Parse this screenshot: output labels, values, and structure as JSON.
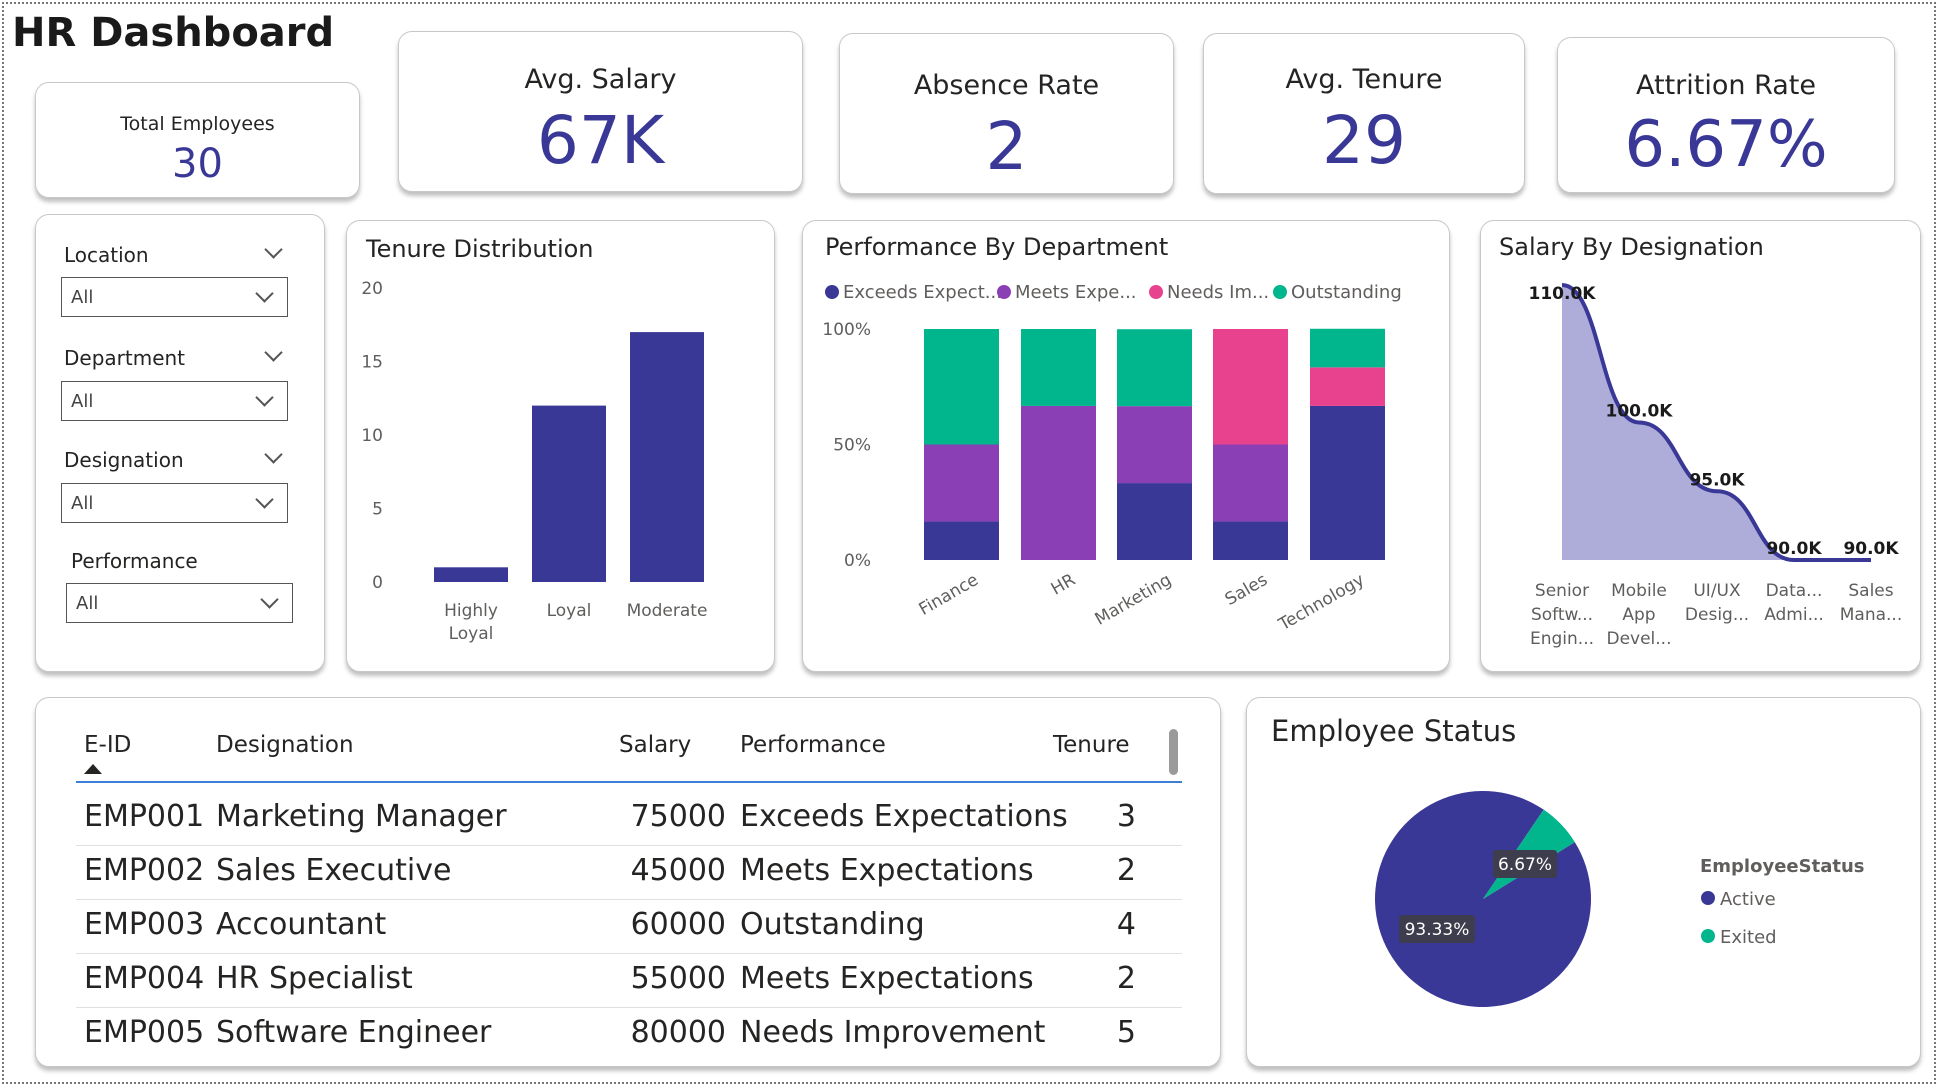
{
  "title": "HR Dashboard",
  "kpis": {
    "total_employees": {
      "label": "Total Employees",
      "value": "30"
    },
    "avg_salary": {
      "label": "Avg. Salary",
      "value": "67K"
    },
    "absence_rate": {
      "label": "Absence Rate",
      "value": "2"
    },
    "avg_tenure": {
      "label": "Avg. Tenure",
      "value": "29"
    },
    "attrition_rate": {
      "label": "Attrition Rate",
      "value": "6.67%"
    }
  },
  "slicers": [
    {
      "label": "Location",
      "value": "All"
    },
    {
      "label": "Department",
      "value": "All"
    },
    {
      "label": "Designation",
      "value": "All"
    },
    {
      "label": "Performance",
      "value": "All"
    }
  ],
  "colors": {
    "navy": "#3a3897",
    "purple": "#8b3fb5",
    "pink": "#e8428e",
    "teal": "#01b58d",
    "area": "#aeadda"
  },
  "chart_data": [
    {
      "id": "tenure",
      "type": "bar",
      "title": "Tenure Distribution",
      "categories": [
        [
          "Highly",
          "Loyal"
        ],
        [
          "Loyal"
        ],
        [
          "Moderate"
        ]
      ],
      "values": [
        1,
        12,
        17
      ],
      "yticks": [
        0,
        5,
        10,
        15,
        20
      ],
      "ylim": [
        0,
        20
      ]
    },
    {
      "id": "performance",
      "type": "bar",
      "stacked": "100%",
      "title": "Performance By Department",
      "legend": [
        "Exceeds Expect...",
        "Meets Expe...",
        "Needs Im...",
        "Outstanding"
      ],
      "categories": [
        "Finance",
        "HR",
        "Marketing",
        "Sales",
        "Technology"
      ],
      "yticks": [
        "0%",
        "50%",
        "100%"
      ],
      "series": [
        {
          "name": "Exceeds Expectations",
          "color": "#3a3897",
          "values": [
            0.167,
            0,
            0.333,
            0.167,
            0.667
          ]
        },
        {
          "name": "Meets Expectations",
          "color": "#8b3fb5",
          "values": [
            0.333,
            0.667,
            0.333,
            0.333,
            0
          ]
        },
        {
          "name": "Needs Improvement",
          "color": "#e8428e",
          "values": [
            0,
            0,
            0,
            0.5,
            0.167
          ]
        },
        {
          "name": "Outstanding",
          "color": "#01b58d",
          "values": [
            0.5,
            0.333,
            0.333,
            0,
            0.167
          ]
        }
      ]
    },
    {
      "id": "salary",
      "type": "area",
      "title": "Salary By Designation",
      "categories": [
        [
          "Senior",
          "Softw...",
          "Engin..."
        ],
        [
          "Mobile",
          "App",
          "Devel..."
        ],
        [
          "UI/UX",
          "Desig..."
        ],
        [
          "Data...",
          "Admi..."
        ],
        [
          "Sales",
          "Mana..."
        ]
      ],
      "values": [
        110000,
        100000,
        95000,
        90000,
        90000
      ],
      "labels": [
        "110.0K",
        "100.0K",
        "95.0K",
        "90.0K",
        "90.0K"
      ]
    },
    {
      "id": "status",
      "type": "pie",
      "title": "Employee Status",
      "legend_title": "EmployeeStatus",
      "slices": [
        {
          "name": "Active",
          "value": 93.33,
          "label": "93.33%",
          "color": "#3a3897"
        },
        {
          "name": "Exited",
          "value": 6.67,
          "label": "6.67%",
          "color": "#01b58d"
        }
      ]
    }
  ],
  "table": {
    "columns": [
      "E-ID",
      "Designation",
      "Salary",
      "Performance",
      "Tenure"
    ],
    "rows": [
      [
        "EMP001",
        "Marketing Manager",
        "75000",
        "Exceeds Expectations",
        "3"
      ],
      [
        "EMP002",
        "Sales Executive",
        "45000",
        "Meets Expectations",
        "2"
      ],
      [
        "EMP003",
        "Accountant",
        "60000",
        "Outstanding",
        "4"
      ],
      [
        "EMP004",
        "HR Specialist",
        "55000",
        "Meets Expectations",
        "2"
      ],
      [
        "EMP005",
        "Software Engineer",
        "80000",
        "Needs Improvement",
        "5"
      ]
    ]
  }
}
